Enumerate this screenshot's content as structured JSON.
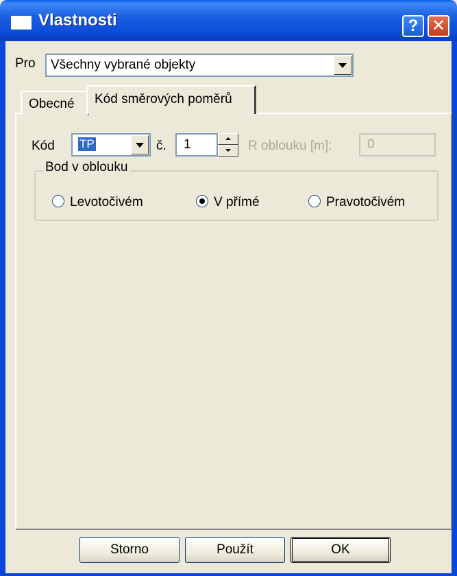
{
  "window": {
    "title": "Vlastnosti",
    "help_label": "?",
    "close_label": "✕"
  },
  "pro": {
    "label": "Pro",
    "value": "Všechny vybrané objekty"
  },
  "tabs": [
    {
      "label": "Obecné",
      "active": false
    },
    {
      "label": "Kód směrových poměrů",
      "active": true
    }
  ],
  "form": {
    "kod_label": "Kód",
    "kod_value": "TP",
    "c_label": "č.",
    "c_value": "1",
    "r_label": "R oblouku [m]:",
    "r_value": "0"
  },
  "group": {
    "title": "Bod v oblouku",
    "options": [
      {
        "label": "Levotočivém",
        "checked": false
      },
      {
        "label": "V přímé",
        "checked": true
      },
      {
        "label": "Pravotočivém",
        "checked": false
      }
    ]
  },
  "buttons": {
    "storno": "Storno",
    "pouzit": "Použít",
    "ok": "OK"
  },
  "colors": {
    "titlebar": "#0a4bd8",
    "dialog_bg": "#ece9d8",
    "selection": "#316ac5",
    "disabled_text": "#aca899"
  }
}
